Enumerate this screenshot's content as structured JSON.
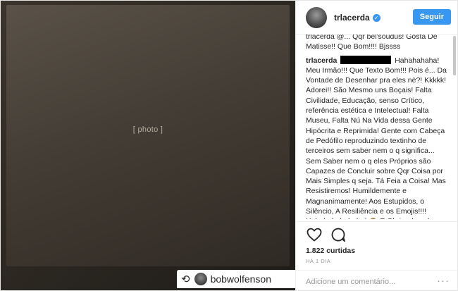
{
  "media": {
    "placeholder_note": "[ photo ]",
    "repost": {
      "icon": "repost-icon",
      "username": "bobwolfenson"
    }
  },
  "header": {
    "username": "trlacerda",
    "verified_icon": "verified-badge-icon",
    "follow_label": "Seguir"
  },
  "comments": {
    "previous_tail": "trlacerda @... Qqr bel'soudus! Gosta De Matisse!! Que Bom!!!! Bjssss",
    "main": {
      "username": "trlacerda",
      "text": "Hahahahaha! Meu Irmão!!! Que Texto Bom!!! Pois é... Da Vontade de Desenhar pra eles nè?! Kkkkk! Adorei!! São Mesmo uns Boçais! Falta Civilidade, Educação, senso Crítico, referência estética e Intelectual! Falta Museu, Falta Nú Na Vida dessa Gente Hipócrita e Reprimida! Gente com Cabeça de Pedófilo reproduzindo textinho de terceiros sem saber nem o q significa... Sem Saber nem o q eles Próprios são Capazes de Concluir sobre Qqr Coisa por Mais Simples q seja. Tá Feia a Coisa! Mas Resistiremos! Humildemente e Magnanimamente! Aos Estupidos, o Silêncio, A Resiliência e os Emojis!!!! Hahahahahahaha! 🙈 E Obrigado pela Generosidade de sair em defesa deste Pobre Cidadão aqui, precupado com o Abismo De Educação de um Povo"
    }
  },
  "actions": {
    "like_icon": "heart-icon",
    "comment_icon": "comment-bubble-icon",
    "likes_text": "1.822 curtidas",
    "time_text": "HÁ 1 DIA",
    "comment_placeholder": "Adicione um comentário...",
    "more_label": "···"
  },
  "colors": {
    "accent": "#3897f0",
    "text": "#262626",
    "muted": "#999999"
  }
}
